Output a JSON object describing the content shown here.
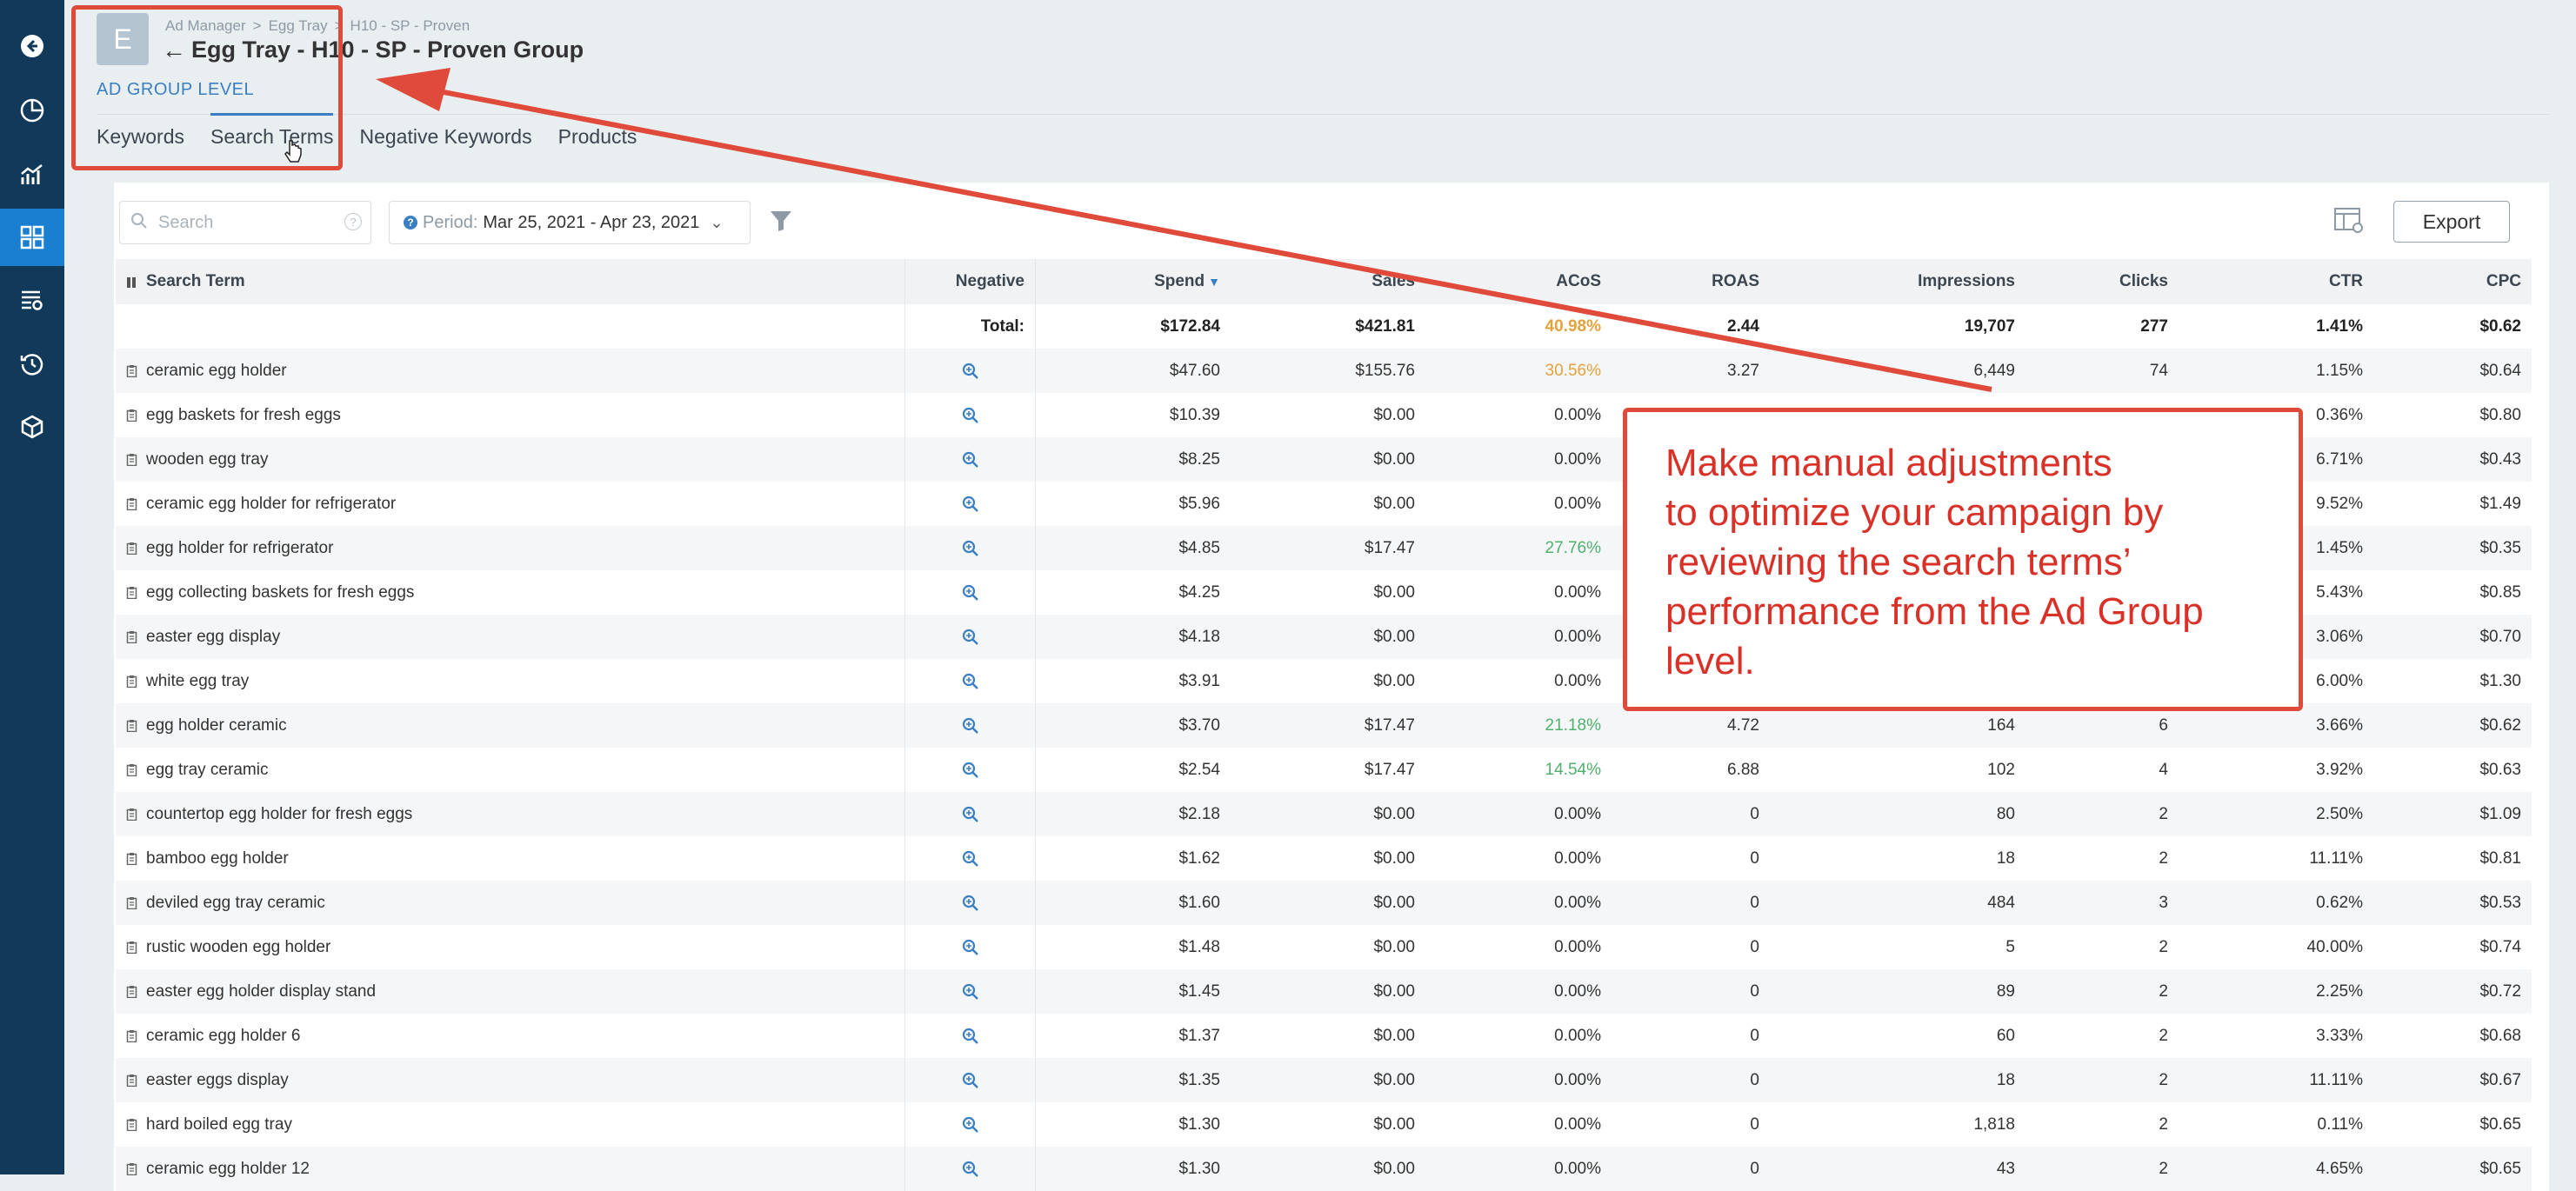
{
  "header": {
    "avatar_letter": "E",
    "breadcrumb": [
      "Ad Manager",
      "Egg Tray",
      "H10 - SP - Proven"
    ],
    "breadcrumb_sep": ">",
    "back_arrow": "←",
    "title": "Egg Tray - H10 - SP - Proven Group",
    "level_label": "AD GROUP LEVEL"
  },
  "tabs": [
    {
      "label": "Keywords",
      "active": false
    },
    {
      "label": "Search Terms",
      "active": true
    },
    {
      "label": "Negative Keywords",
      "active": false
    },
    {
      "label": "Products",
      "active": false
    }
  ],
  "toolbar": {
    "search_placeholder": "Search",
    "help_glyph": "?",
    "period_label": "Period:",
    "period_value": "Mar 25, 2021 - Apr 23, 2021",
    "export_label": "Export"
  },
  "sidebar_icons": [
    "back-circle-icon",
    "clock-icon",
    "analytics-icon",
    "dashboard-icon",
    "list-settings-icon",
    "history-icon",
    "product-box-icon"
  ],
  "table": {
    "columns": {
      "term": "Search Term",
      "negative": "Negative",
      "spend": "Spend",
      "sales": "Sales",
      "acos": "ACoS",
      "roas": "ROAS",
      "impressions": "Impressions",
      "clicks": "Clicks",
      "ctr": "CTR",
      "cpc": "CPC"
    },
    "total": {
      "label": "Total:",
      "spend": "$172.84",
      "sales": "$421.81",
      "acos": "40.98%",
      "roas": "2.44",
      "impressions": "19,707",
      "clicks": "277",
      "ctr": "1.41%",
      "cpc": "$0.62"
    },
    "rows": [
      {
        "term": "ceramic egg holder",
        "spend": "$47.60",
        "sales": "$155.76",
        "acos": "30.56%",
        "acos_color": "orange",
        "roas": "3.27",
        "impressions": "6,449",
        "clicks": "74",
        "ctr": "1.15%",
        "cpc": "$0.64"
      },
      {
        "term": "egg baskets for fresh eggs",
        "spend": "$10.39",
        "sales": "$0.00",
        "acos": "0.00%",
        "roas": "",
        "impressions": "",
        "clicks": "",
        "ctr": "0.36%",
        "cpc": "$0.80"
      },
      {
        "term": "wooden egg tray",
        "spend": "$8.25",
        "sales": "$0.00",
        "acos": "0.00%",
        "roas": "",
        "impressions": "",
        "clicks": "",
        "ctr": "6.71%",
        "cpc": "$0.43"
      },
      {
        "term": "ceramic egg holder for refrigerator",
        "spend": "$5.96",
        "sales": "$0.00",
        "acos": "0.00%",
        "roas": "",
        "impressions": "",
        "clicks": "",
        "ctr": "9.52%",
        "cpc": "$1.49"
      },
      {
        "term": "egg holder for refrigerator",
        "spend": "$4.85",
        "sales": "$17.47",
        "acos": "27.76%",
        "acos_color": "green",
        "roas": "",
        "impressions": "",
        "clicks": "",
        "ctr": "1.45%",
        "cpc": "$0.35"
      },
      {
        "term": "egg collecting baskets for fresh eggs",
        "spend": "$4.25",
        "sales": "$0.00",
        "acos": "0.00%",
        "roas": "",
        "impressions": "",
        "clicks": "",
        "ctr": "5.43%",
        "cpc": "$0.85"
      },
      {
        "term": "easter egg display",
        "spend": "$4.18",
        "sales": "$0.00",
        "acos": "0.00%",
        "roas": "",
        "impressions": "",
        "clicks": "",
        "ctr": "3.06%",
        "cpc": "$0.70"
      },
      {
        "term": "white egg tray",
        "spend": "$3.91",
        "sales": "$0.00",
        "acos": "0.00%",
        "roas": "",
        "impressions": "",
        "clicks": "",
        "ctr": "6.00%",
        "cpc": "$1.30"
      },
      {
        "term": "egg holder ceramic",
        "spend": "$3.70",
        "sales": "$17.47",
        "acos": "21.18%",
        "acos_color": "green",
        "roas": "4.72",
        "impressions": "164",
        "clicks": "6",
        "ctr": "3.66%",
        "cpc": "$0.62"
      },
      {
        "term": "egg tray ceramic",
        "spend": "$2.54",
        "sales": "$17.47",
        "acos": "14.54%",
        "acos_color": "green",
        "roas": "6.88",
        "impressions": "102",
        "clicks": "4",
        "ctr": "3.92%",
        "cpc": "$0.63"
      },
      {
        "term": "countertop egg holder for fresh eggs",
        "spend": "$2.18",
        "sales": "$0.00",
        "acos": "0.00%",
        "roas": "0",
        "impressions": "80",
        "clicks": "2",
        "ctr": "2.50%",
        "cpc": "$1.09"
      },
      {
        "term": "bamboo egg holder",
        "spend": "$1.62",
        "sales": "$0.00",
        "acos": "0.00%",
        "roas": "0",
        "impressions": "18",
        "clicks": "2",
        "ctr": "11.11%",
        "cpc": "$0.81"
      },
      {
        "term": "deviled egg tray ceramic",
        "spend": "$1.60",
        "sales": "$0.00",
        "acos": "0.00%",
        "roas": "0",
        "impressions": "484",
        "clicks": "3",
        "ctr": "0.62%",
        "cpc": "$0.53"
      },
      {
        "term": "rustic wooden egg holder",
        "spend": "$1.48",
        "sales": "$0.00",
        "acos": "0.00%",
        "roas": "0",
        "impressions": "5",
        "clicks": "2",
        "ctr": "40.00%",
        "cpc": "$0.74"
      },
      {
        "term": "easter egg holder display stand",
        "spend": "$1.45",
        "sales": "$0.00",
        "acos": "0.00%",
        "roas": "0",
        "impressions": "89",
        "clicks": "2",
        "ctr": "2.25%",
        "cpc": "$0.72"
      },
      {
        "term": "ceramic egg holder 6",
        "spend": "$1.37",
        "sales": "$0.00",
        "acos": "0.00%",
        "roas": "0",
        "impressions": "60",
        "clicks": "2",
        "ctr": "3.33%",
        "cpc": "$0.68"
      },
      {
        "term": "easter eggs display",
        "spend": "$1.35",
        "sales": "$0.00",
        "acos": "0.00%",
        "roas": "0",
        "impressions": "18",
        "clicks": "2",
        "ctr": "11.11%",
        "cpc": "$0.67"
      },
      {
        "term": "hard boiled egg tray",
        "spend": "$1.30",
        "sales": "$0.00",
        "acos": "0.00%",
        "roas": "0",
        "impressions": "1,818",
        "clicks": "2",
        "ctr": "0.11%",
        "cpc": "$0.65"
      },
      {
        "term": "ceramic egg holder 12",
        "spend": "$1.30",
        "sales": "$0.00",
        "acos": "0.00%",
        "roas": "0",
        "impressions": "43",
        "clicks": "2",
        "ctr": "4.65%",
        "cpc": "$0.65"
      }
    ]
  },
  "annotation": {
    "callout_lines": [
      "Make manual adjustments",
      "to optimize your campaign by",
      "reviewing the search terms’",
      "performance from the Ad Group",
      "level."
    ],
    "color": "#e04a3a"
  },
  "colors": {
    "sidebar": "#113a5a",
    "sidebar_active": "#1a7fd1",
    "accent": "#3a7fc4",
    "acos_orange": "#e3a23c",
    "acos_green": "#4fb06c"
  }
}
